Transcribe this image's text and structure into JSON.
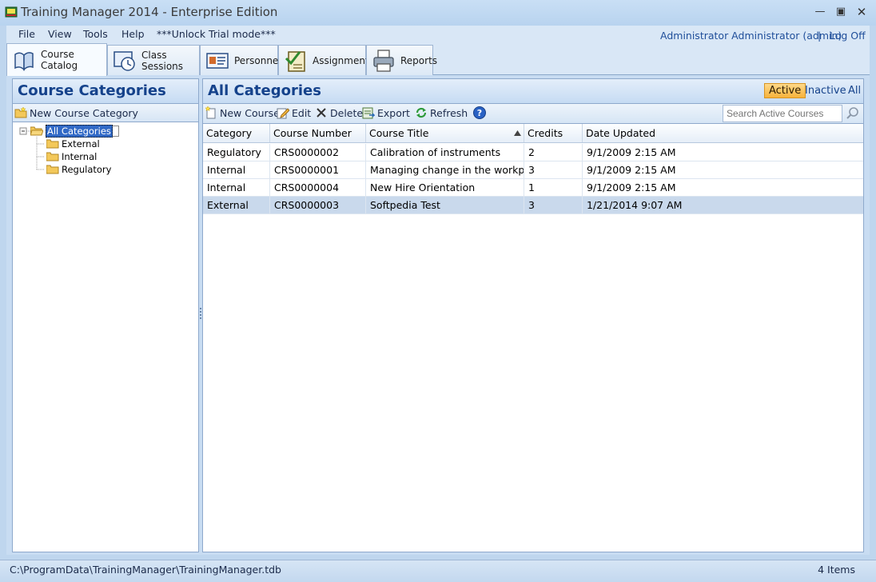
{
  "window": {
    "title": "Training Manager 2014 - Enterprise Edition"
  },
  "menu": {
    "items": [
      "File",
      "View",
      "Tools",
      "Help",
      "***Unlock Trial mode***"
    ],
    "user": "Administrator Administrator (admin)",
    "separator": "|",
    "logoff": "Log Off"
  },
  "tabs": [
    {
      "label": "Course Catalog",
      "icon": "book-icon",
      "active": true
    },
    {
      "label": "Class Sessions",
      "icon": "clock-icon",
      "active": false
    },
    {
      "label": "Personnel",
      "icon": "id-card-icon",
      "active": false
    },
    {
      "label": "Assignments",
      "icon": "checklist-icon",
      "active": false
    },
    {
      "label": "Reports",
      "icon": "printer-icon",
      "active": false
    }
  ],
  "left": {
    "title": "Course Categories",
    "new_category": "New Course Category",
    "tree": {
      "root": "All Categories",
      "children": [
        "External",
        "Internal",
        "Regulatory"
      ]
    }
  },
  "right": {
    "title": "All Categories",
    "filters": [
      "Active",
      "Inactive",
      "All"
    ],
    "toolbar": {
      "new_course": "New Course",
      "edit": "Edit",
      "delete": "Delete",
      "export": "Export",
      "refresh": "Refresh"
    },
    "search_placeholder": "Search Active Courses",
    "columns": [
      "Category",
      "Course Number",
      "Course Title",
      "Credits",
      "Date Updated"
    ],
    "rows": [
      [
        "Regulatory",
        "CRS0000002",
        "Calibration of instruments",
        "2",
        "9/1/2009 2:15 AM"
      ],
      [
        "Internal",
        "CRS0000001",
        "Managing change in the workplace",
        "3",
        "9/1/2009 2:15 AM"
      ],
      [
        "Internal",
        "CRS0000004",
        "New Hire Orientation",
        "1",
        "9/1/2009 2:15 AM"
      ],
      [
        "External",
        "CRS0000003",
        "Softpedia Test",
        "3",
        "1/21/2014 9:07 AM"
      ]
    ]
  },
  "status": {
    "path": "C:\\ProgramData\\TrainingManager\\TrainingManager.tdb",
    "count": "4 Items"
  },
  "colors": {
    "accent": "#15428b",
    "active_filter": "#f7b23b",
    "selected_row": "#c9d9ec"
  }
}
